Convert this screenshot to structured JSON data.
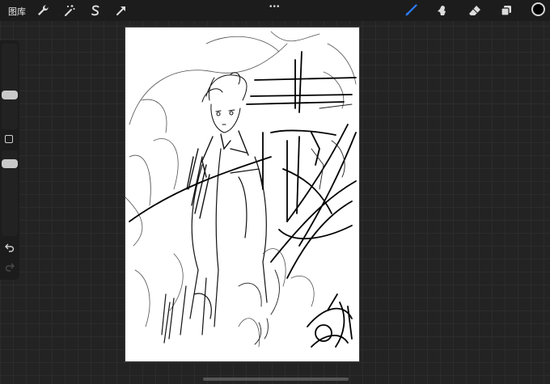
{
  "topbar": {
    "gallery_label": "图库",
    "more_label": "•••",
    "tools": {
      "actions": "wrench-icon",
      "adjustments": "magic-wand-icon",
      "selection": "selection-s-icon",
      "transform": "transform-arrow-icon",
      "brush": "brush-icon",
      "smudge": "smudge-icon",
      "eraser": "eraser-icon",
      "layers": "layers-icon"
    },
    "active_tool": "brush",
    "colors": {
      "brush_active": "#2e7cf6",
      "current_color": "#000000"
    }
  },
  "sidebar": {
    "brush_size_level": 0.39,
    "opacity_level": 0.41,
    "undo_icon": "undo-icon",
    "redo_icon": "redo-icon"
  }
}
